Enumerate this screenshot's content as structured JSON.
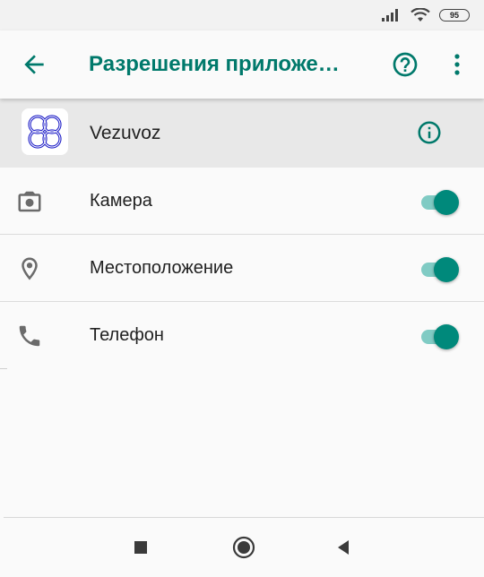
{
  "status_bar": {
    "battery_level": "95",
    "icons": [
      "signal-icon",
      "wifi-icon",
      "battery-icon"
    ]
  },
  "toolbar": {
    "title": "Разрешения приложе…",
    "back_icon": "back-arrow-icon",
    "help_icon": "help-icon",
    "more_icon": "more-vert-icon"
  },
  "app": {
    "name": "Vezuvoz",
    "info_icon": "info-icon"
  },
  "permissions": [
    {
      "label": "Камера",
      "icon": "camera-icon",
      "enabled": true
    },
    {
      "label": "Местоположение",
      "icon": "location-icon",
      "enabled": true
    },
    {
      "label": "Телефон",
      "icon": "phone-icon",
      "enabled": true
    }
  ],
  "nav_bar": {
    "buttons": [
      "recents-button",
      "home-button",
      "back-button"
    ]
  },
  "colors": {
    "accent": "#00796b",
    "switch_thumb": "#00897b",
    "switch_track": "#80cbc4",
    "app_icon_blue": "#2121c8"
  }
}
